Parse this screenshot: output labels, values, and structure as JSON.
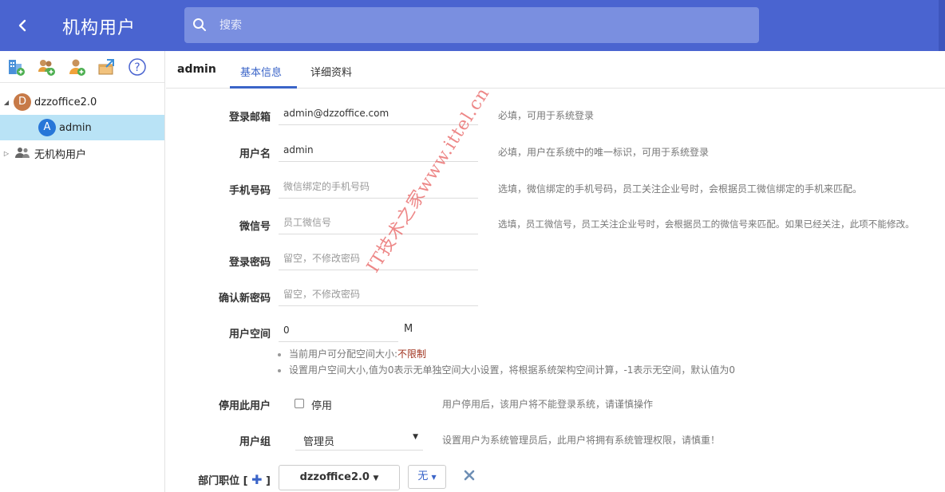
{
  "header": {
    "title": "机构用户",
    "search_placeholder": "搜索",
    "brand_color": "#4a64d0"
  },
  "sidebar": {
    "toolbar_icons": [
      "add-org-icon",
      "add-group-icon",
      "add-user-icon",
      "import-icon",
      "help-icon"
    ],
    "tree": [
      {
        "label": "dzzoffice2.0",
        "avatar": "D",
        "expanded": true
      },
      {
        "label": "admin",
        "avatar": "A",
        "selected": true
      },
      {
        "label": "无机构用户",
        "expanded": false
      }
    ]
  },
  "tabs": {
    "username": "admin",
    "items": [
      {
        "label": "基本信息",
        "active": true
      },
      {
        "label": "详细资料",
        "active": false
      }
    ]
  },
  "form": {
    "email": {
      "label": "登录邮箱",
      "value": "admin@dzzoffice.com",
      "hint": "必填，可用于系统登录"
    },
    "username": {
      "label": "用户名",
      "value": "admin",
      "hint": "必填，用户在系统中的唯一标识，可用于系统登录"
    },
    "phone": {
      "label": "手机号码",
      "placeholder": "微信绑定的手机号码",
      "hint": "选填，微信绑定的手机号码，员工关注企业号时，会根据员工微信绑定的手机来匹配。"
    },
    "wechat": {
      "label": "微信号",
      "placeholder": "员工微信号",
      "hint": "选填，员工微信号，员工关注企业号时，会根据员工的微信号来匹配。如果已经关注，此项不能修改。"
    },
    "password": {
      "label": "登录密码",
      "placeholder": "留空，不修改密码"
    },
    "confirm_password": {
      "label": "确认新密码",
      "placeholder": "留空，不修改密码"
    },
    "space": {
      "label": "用户空间",
      "value": "0",
      "unit": "M",
      "note1_prefix": "当前用户可分配空间大小:",
      "note1_value": "不限制",
      "note2": "设置用户空间大小,值为0表示无单独空间大小设置，将根据系统架构空间计算，-1表示无空间，默认值为0"
    },
    "disable": {
      "label": "停用此用户",
      "checkbox_label": "停用",
      "checked": false,
      "hint": "用户停用后，该用户将不能登录系统，请谨慎操作"
    },
    "group": {
      "label": "用户组",
      "value": "管理员",
      "hint": "设置用户为系统管理员后，此用户将拥有系统管理权限，请慎重！"
    },
    "department": {
      "label_prefix": "部门职位 [",
      "label_suffix": "]",
      "plus": "✚",
      "dept_value": "dzzoffice2.0",
      "position_value": "无"
    }
  },
  "watermark": "IT技术之家www.ittel.cn"
}
